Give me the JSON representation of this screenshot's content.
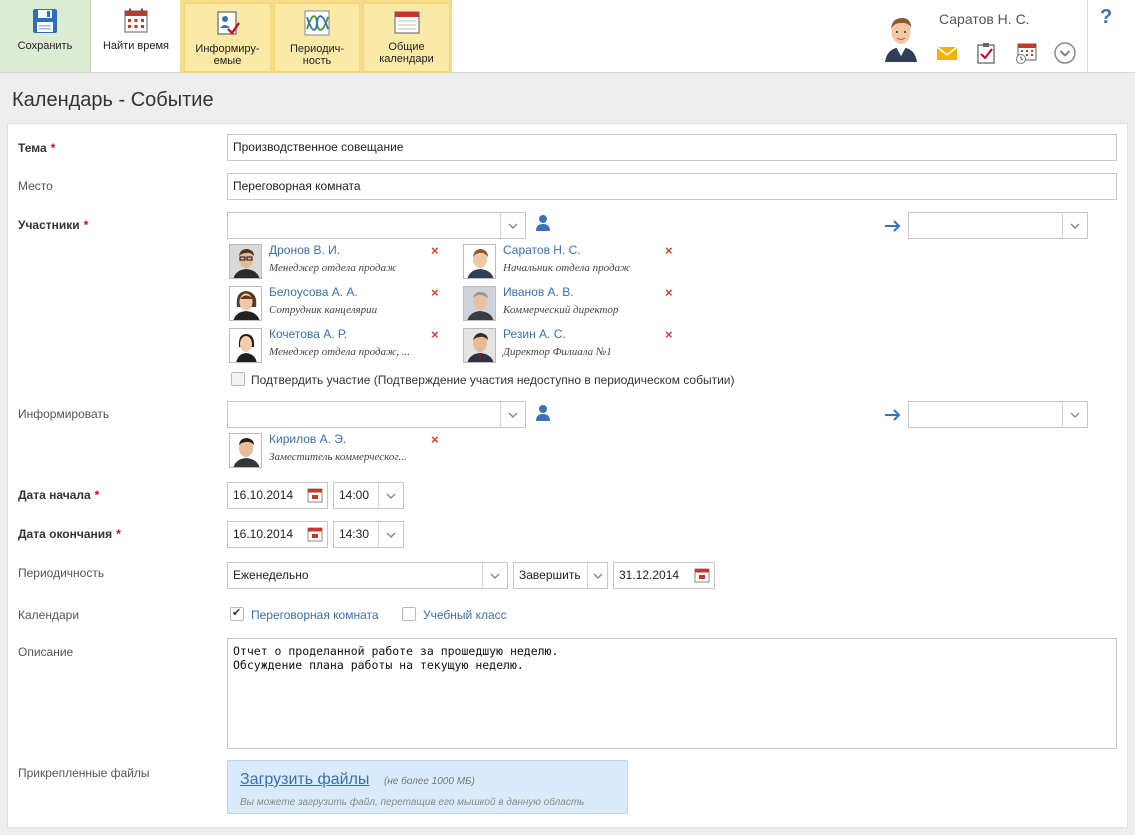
{
  "toolbar": {
    "save": "Сохранить",
    "find_time": "Найти время",
    "inform_line1": "Информиру-",
    "inform_line2": "емые",
    "period_line1": "Периодич-",
    "period_line2": "ность",
    "calendars_line1": "Общие",
    "calendars_line2": "календари"
  },
  "user": {
    "name": "Саратов Н. С.",
    "help": "?"
  },
  "page": {
    "title": "Календарь - Событие"
  },
  "form": {
    "subject_label": "Тема",
    "subject_value": "Производственное совещание",
    "place_label": "Место",
    "place_value": "Переговорная комната",
    "participants_label": "Участники",
    "participants": [
      {
        "name": "Дронов В. И.",
        "position": "Менеджер отдела продаж"
      },
      {
        "name": "Саратов Н. С.",
        "position": "Начальник отдела продаж"
      },
      {
        "name": "Белоусова А. А.",
        "position": "Сотрудник канцелярии"
      },
      {
        "name": "Иванов А. В.",
        "position": "Коммерческий директор"
      },
      {
        "name": "Кочетова А. Р.",
        "position": "Менеджер отдела продаж, ..."
      },
      {
        "name": "Резин А. С.",
        "position": "Директор Филиала №1"
      }
    ],
    "remove_glyph": "×",
    "confirm_label": "Подтвердить участие (Подтверждение участия недоступно в периодическом событии)",
    "inform_label": "Информировать",
    "informed": [
      {
        "name": "Кирилов А. Э.",
        "position": "Заместитель коммерческог..."
      }
    ],
    "start_label": "Дата начала",
    "start_date": "16.10.2014",
    "start_time": "14:00",
    "end_label": "Дата окончания",
    "end_date": "16.10.2014",
    "end_time": "14:30",
    "period_label": "Периодичность",
    "period_value": "Еженедельно",
    "period_end_mode": "Завершить",
    "period_end_date": "31.12.2014",
    "calendars_label": "Календари",
    "calendars": [
      {
        "name": "Переговорная комната",
        "checked": true
      },
      {
        "name": "Учебный класс",
        "checked": false
      }
    ],
    "description_label": "Описание",
    "description": "Отчет о проделанной работе за прошедшую неделю.\nОбсуждение плана работы на текущую неделю.",
    "files_label": "Прикрепленные файлы",
    "upload_link": "Загрузить файлы",
    "upload_limit": "(не более 1000 МБ)",
    "upload_hint": "Вы можете загрузить файл, перетащив его мышкой в данную область"
  },
  "colors": {
    "accent": "#3a6fb0",
    "required": "#d0021b",
    "remove": "#e23c2c",
    "toolbar_yellow": "#fbe9a7",
    "save_green": "#dcebd4"
  },
  "icons": {
    "save": "floppy-disk-icon",
    "find_time": "calendar-grid-icon",
    "inform": "person-check-icon",
    "period": "periodic-chart-icon",
    "calendars": "calendar-icon",
    "mail": "envelope-icon",
    "tasks": "clipboard-check-icon",
    "schedule": "calendar-clock-icon",
    "more": "chevron-down-circle-icon",
    "person_picker": "person-icon",
    "forward": "arrow-right-icon"
  }
}
